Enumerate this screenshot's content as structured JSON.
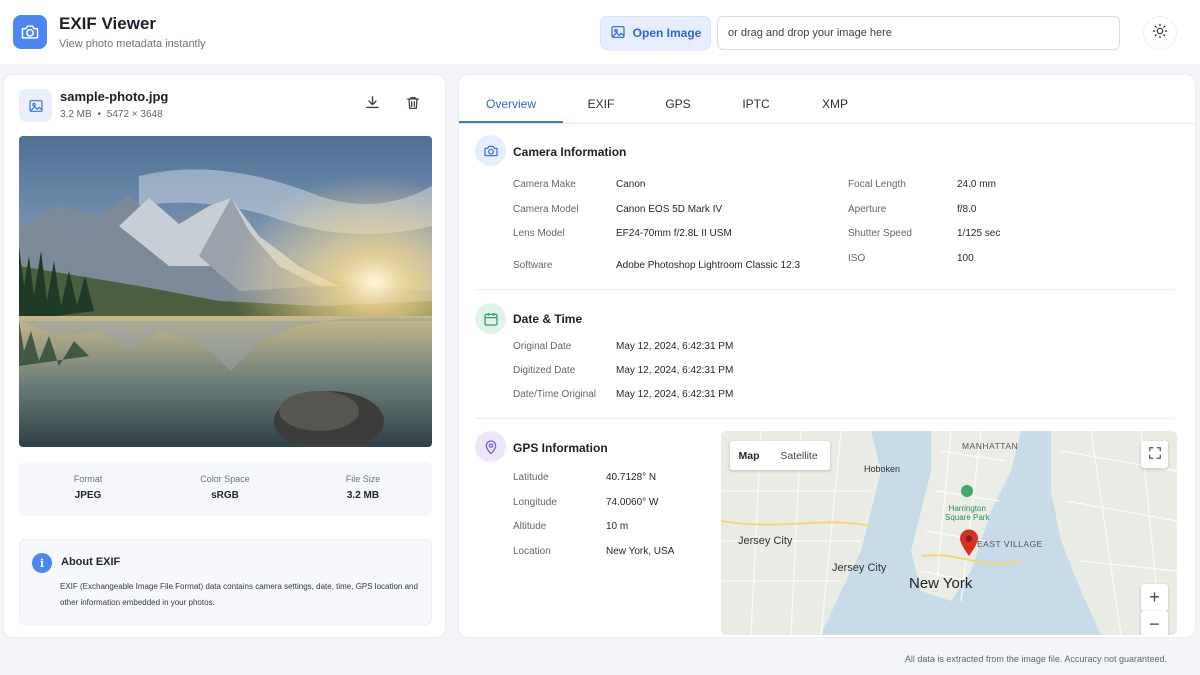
{
  "app": {
    "title": "EXIF Viewer",
    "subtitle": "View photo metadata instantly",
    "open_label": "Open Image",
    "drop_placeholder": "or drag and drop your image here",
    "logo_icon": "camera-icon",
    "theme_icon": "sun-icon"
  },
  "file": {
    "name": "sample-photo.jpg",
    "size": "3.2 MB",
    "separator": "•",
    "dimensions": "5472 × 3648",
    "stats": [
      {
        "label": "Format",
        "value": "JPEG"
      },
      {
        "label": "Color Space",
        "value": "sRGB"
      },
      {
        "label": "File Size",
        "value": "3.2 MB"
      }
    ]
  },
  "about": {
    "icon": "i",
    "title": "About EXIF",
    "text": "EXIF (Exchangeable Image File Format) data contains camera settings, date, time, GPS location and other information embedded in your photos."
  },
  "tabs": [
    "Overview",
    "EXIF",
    "GPS",
    "IPTC",
    "XMP"
  ],
  "active_tab": "Overview",
  "camera": {
    "title": "Camera Information",
    "left": [
      {
        "label": "Camera Make",
        "value": "Canon"
      },
      {
        "label": "Camera Model",
        "value": "Canon EOS 5D Mark IV"
      },
      {
        "label": "Lens Model",
        "value": "EF24-70mm f/2.8L II USM"
      },
      {
        "label": "Software",
        "value": "Adobe Photoshop Lightroom Classic 12.3"
      }
    ],
    "right": [
      {
        "label": "Focal Length",
        "value": "24.0 mm"
      },
      {
        "label": "Aperture",
        "value": "f/8.0"
      },
      {
        "label": "Shutter Speed",
        "value": "1/125 sec"
      },
      {
        "label": "ISO",
        "value": "100"
      }
    ]
  },
  "datetime": {
    "title": "Date & Time",
    "rows": [
      {
        "label": "Original Date",
        "value": "May 12, 2024, 6:42:31 PM"
      },
      {
        "label": "Digitized Date",
        "value": "May 12, 2024, 6:42:31 PM"
      },
      {
        "label": "Date/Time Original",
        "value": "May 12, 2024, 6:42:31 PM"
      }
    ]
  },
  "gps": {
    "title": "GPS Information",
    "rows": [
      {
        "label": "Latitude",
        "value": "40.7128° N"
      },
      {
        "label": "Longitude",
        "value": "74.0060° W"
      },
      {
        "label": "Altitude",
        "value": "10 m"
      },
      {
        "label": "Location",
        "value": "New York, USA"
      }
    ]
  },
  "map": {
    "map_label": "Map",
    "satellite_label": "Satellite",
    "zoom_in": "+",
    "zoom_out": "−",
    "places": {
      "manhattan": "MANHATTAN",
      "hoboken": "Hoboken",
      "jersey_city_1": "Jersey City",
      "jersey_city_2": "Jersey City",
      "new_york": "New York",
      "harrington": "Harrington",
      "square_park": "Square Park",
      "east_village": "EAST VILLAGE"
    }
  },
  "footer": "All data is extracted from the image file. Accuracy not guaranteed.",
  "colors": {
    "accent": "#3b74e6",
    "camera_icon_bg": "#e6eefc",
    "date_icon_bg": "#dff3ea",
    "gps_icon_bg": "#ece6fb",
    "map_pin": "#d93025"
  }
}
